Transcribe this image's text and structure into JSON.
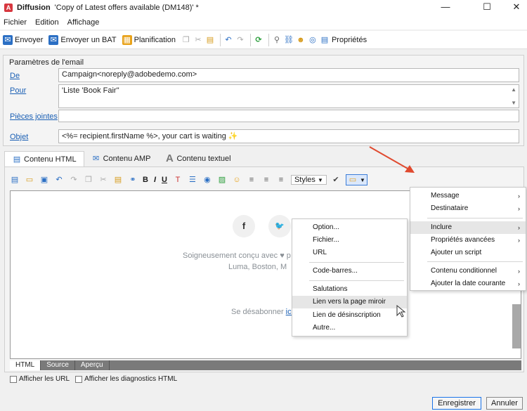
{
  "titlebar": {
    "app_name": "Diffusion",
    "document": "'Copy of Latest offers available (DM148)' *",
    "minimize": "—",
    "maximize": "☐",
    "close": "✕"
  },
  "menubar": {
    "items": [
      "Fichier",
      "Edition",
      "Affichage"
    ]
  },
  "toolbar": {
    "send": "Envoyer",
    "send_bat": "Envoyer un BAT",
    "planning": "Planification",
    "properties": "Propriétés"
  },
  "email_params": {
    "title": "Paramètres de l'email",
    "from_label": "De",
    "from_value": "Campaign<noreply@adobedemo.com>",
    "to_label": "Pour",
    "to_value": "'Liste 'Book Fair''",
    "attachments_label": "Pièces jointes",
    "attachments_value": "",
    "subject_label": "Objet",
    "subject_value": "<%= recipient.firstName %>, your cart is waiting ✨"
  },
  "content_tabs": [
    "Contenu HTML",
    "Contenu AMP",
    "Contenu textuel"
  ],
  "editor_toolbar": {
    "bold": "B",
    "italic": "I",
    "underline": "U",
    "styles": "Styles"
  },
  "preview": {
    "social_facebook": "f",
    "social_twitter": "🐦",
    "line1": "Soigneusement conçu avec ♥ p",
    "line2": "Luma, Boston, M",
    "line3_prefix": "Se désabonner ",
    "line3_link": "ici"
  },
  "bottom_tabs": [
    "HTML",
    "Source",
    "Aperçu"
  ],
  "checkboxes": {
    "show_urls": "Afficher les URL",
    "show_diagnostics": "Afficher les diagnostics HTML"
  },
  "buttons": {
    "save": "Enregistrer",
    "cancel": "Annuler"
  },
  "main_menu": {
    "message": "Message",
    "recipient": "Destinataire",
    "include": "Inclure",
    "advanced_props": "Propriétés avancées",
    "add_script": "Ajouter un script",
    "conditional": "Contenu conditionnel",
    "add_date": "Ajouter la date courante"
  },
  "sub_menu": {
    "option": "Option...",
    "file": "Fichier...",
    "url": "URL",
    "barcode": "Code-barres...",
    "greetings": "Salutations",
    "mirror": "Lien vers la page miroir",
    "unsubscribe": "Lien de désinscription",
    "other": "Autre..."
  },
  "colors": {
    "accent_red": "#d7373f",
    "link_blue": "#1a5fb4",
    "arrow_red": "#e04a2f"
  }
}
